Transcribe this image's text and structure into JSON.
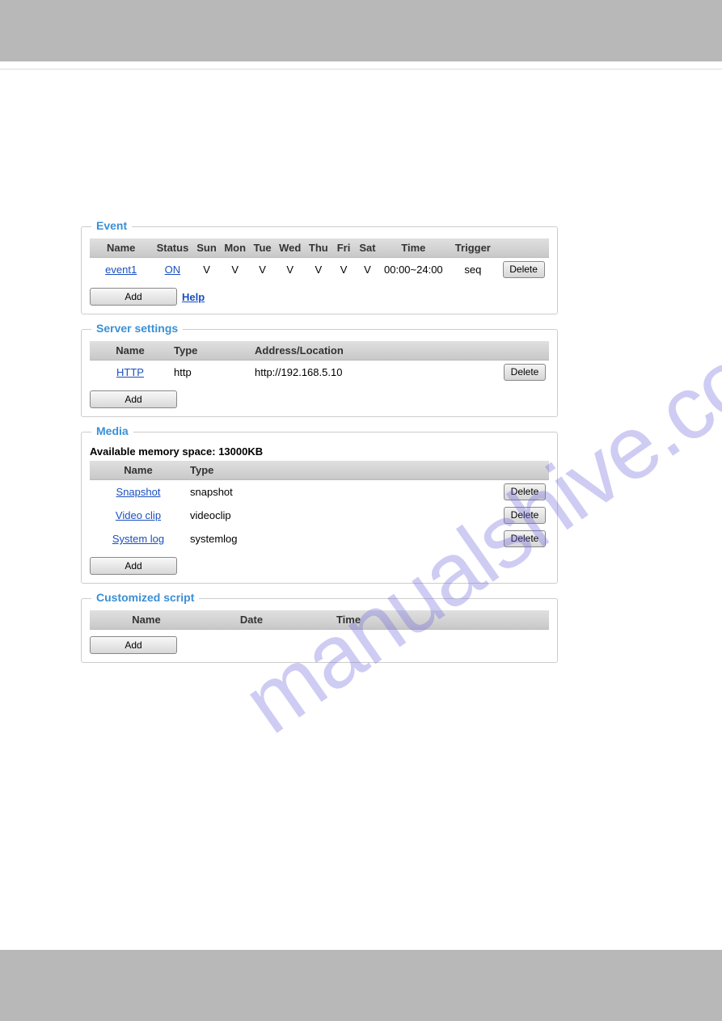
{
  "watermark": "manualshive.com",
  "buttons": {
    "add": "Add",
    "delete": "Delete",
    "help": "Help"
  },
  "event": {
    "legend": "Event",
    "headers": {
      "name": "Name",
      "status": "Status",
      "sun": "Sun",
      "mon": "Mon",
      "tue": "Tue",
      "wed": "Wed",
      "thu": "Thu",
      "fri": "Fri",
      "sat": "Sat",
      "time": "Time",
      "trigger": "Trigger"
    },
    "row": {
      "name": "event1",
      "status": "ON",
      "sun": "V",
      "mon": "V",
      "tue": "V",
      "wed": "V",
      "thu": "V",
      "fri": "V",
      "sat": "V",
      "time": "00:00~24:00",
      "trigger": "seq"
    }
  },
  "server": {
    "legend": "Server settings",
    "headers": {
      "name": "Name",
      "type": "Type",
      "address": "Address/Location"
    },
    "row": {
      "name": "HTTP",
      "type": "http",
      "address": "http://192.168.5.10"
    }
  },
  "media": {
    "legend": "Media",
    "memspace": "Available memory space: 13000KB",
    "headers": {
      "name": "Name",
      "type": "Type"
    },
    "rows": [
      {
        "name": "Snapshot",
        "type": "snapshot"
      },
      {
        "name": "Video clip",
        "type": "videoclip"
      },
      {
        "name": "System log",
        "type": "systemlog"
      }
    ]
  },
  "script": {
    "legend": "Customized script",
    "headers": {
      "name": "Name",
      "date": "Date",
      "time": "Time"
    }
  }
}
